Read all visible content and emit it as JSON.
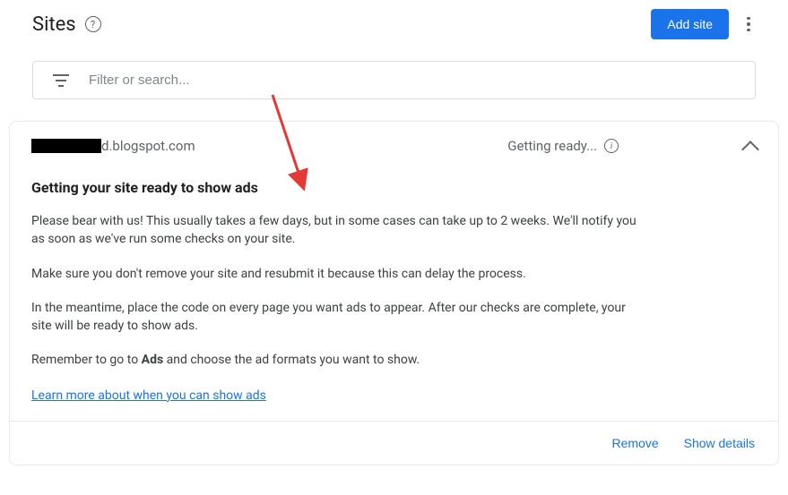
{
  "header": {
    "title": "Sites",
    "add_button": "Add site"
  },
  "filter": {
    "placeholder": "Filter or search..."
  },
  "site": {
    "url_suffix": "d.blogspot.com",
    "status": "Getting ready..."
  },
  "content": {
    "heading": "Getting your site ready to show ads",
    "p1": "Please bear with us! This usually takes a few days, but in some cases can take up to 2 weeks. We'll notify you as soon as we've run some checks on your site.",
    "p2": "Make sure you don't remove your site and resubmit it because this can delay the process.",
    "p3": "In the meantime, place the code on every page you want ads to appear. After our checks are complete, your site will be ready to show ads.",
    "p4_pre": "Remember to go to ",
    "p4_bold": "Ads",
    "p4_post": " and choose the ad formats you want to show.",
    "learn_more": "Learn more about when you can show ads"
  },
  "footer": {
    "remove": "Remove",
    "details": "Show details"
  }
}
